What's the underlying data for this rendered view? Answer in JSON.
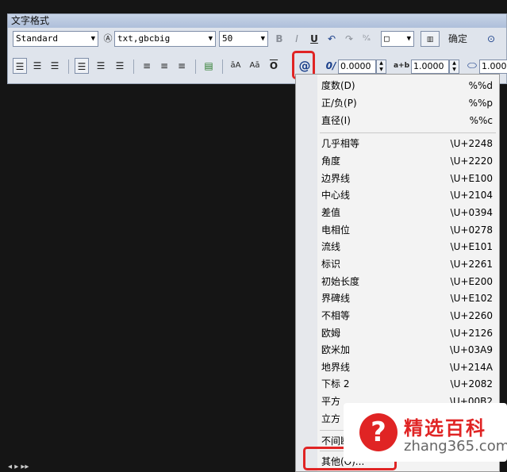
{
  "window": {
    "title": "文字格式"
  },
  "row1": {
    "style_combo": "Standard",
    "font_combo": "txt,gbcbig",
    "height_combo": "50",
    "bold": "B",
    "italic": "I",
    "underline": "U",
    "undo": "↶",
    "redo": "↷",
    "confirm_label": "确定"
  },
  "row2": {
    "symbol_button": "@",
    "oblique_icon": "0/",
    "oblique_value": "0.0000",
    "tracking_icon": "a+b",
    "tracking_value": "1.0000",
    "width_value": "1.000"
  },
  "menu": {
    "items": [
      {
        "label": "度数(D)",
        "code": "%%d"
      },
      {
        "label": "正/负(P)",
        "code": "%%p"
      },
      {
        "label": "直径(I)",
        "code": "%%c"
      },
      {
        "label": "几乎相等",
        "code": "\\U+2248"
      },
      {
        "label": "角度",
        "code": "\\U+2220"
      },
      {
        "label": "边界线",
        "code": "\\U+E100"
      },
      {
        "label": "中心线",
        "code": "\\U+2104"
      },
      {
        "label": "差值",
        "code": "\\U+0394"
      },
      {
        "label": "电相位",
        "code": "\\U+0278"
      },
      {
        "label": "流线",
        "code": "\\U+E101"
      },
      {
        "label": "标识",
        "code": "\\U+2261"
      },
      {
        "label": "初始长度",
        "code": "\\U+E200"
      },
      {
        "label": "界碑线",
        "code": "\\U+E102"
      },
      {
        "label": "不相等",
        "code": "\\U+2260"
      },
      {
        "label": "欧姆",
        "code": "\\U+2126"
      },
      {
        "label": "欧米加",
        "code": "\\U+03A9"
      },
      {
        "label": "地界线",
        "code": "\\U+214A"
      },
      {
        "label": "下标 2",
        "code": "\\U+2082"
      },
      {
        "label": "平方",
        "code": "\\U+00B2"
      },
      {
        "label": "立方",
        "code": ""
      },
      {
        "label": "不间断",
        "code": ""
      },
      {
        "label": "其他(O)...",
        "code": ""
      }
    ]
  },
  "watermark": {
    "cn": "精选百科",
    "url": "zhang365.com"
  },
  "colors": {
    "highlight": "#e02424",
    "menu_bg": "#f3f3f3",
    "toolbar_bg": "#dfe4ec"
  },
  "icons": [
    "bold-icon",
    "italic-icon",
    "underline-icon",
    "undo-icon",
    "redo-icon",
    "stack-icon",
    "ruler-icon",
    "options-icon",
    "align-icon",
    "symbol-icon"
  ]
}
